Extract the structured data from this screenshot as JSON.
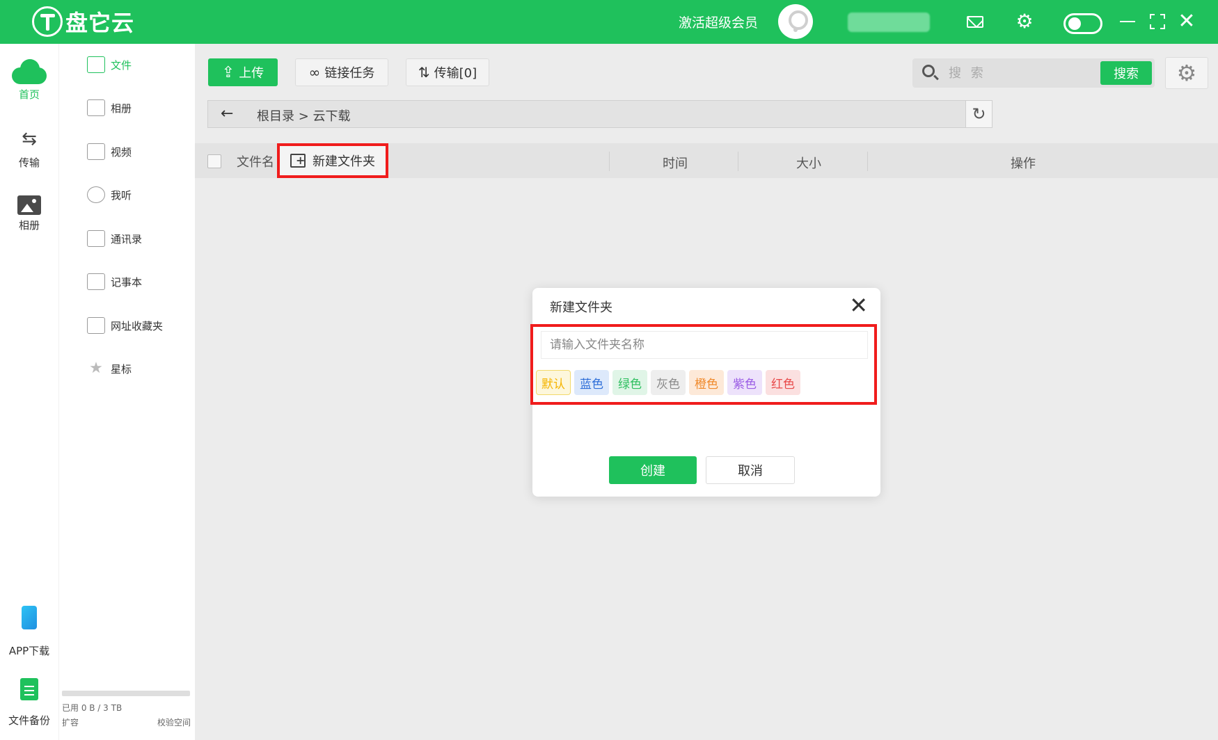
{
  "app": {
    "logo_text": "盘它云",
    "vip_label": "激活超级会员"
  },
  "rail": {
    "items": [
      {
        "label": "首页"
      },
      {
        "label": "传输"
      },
      {
        "label": "相册"
      },
      {
        "label": "APP下载"
      },
      {
        "label": "文件备份"
      }
    ]
  },
  "sidebar": {
    "items": [
      {
        "label": "文件"
      },
      {
        "label": "相册"
      },
      {
        "label": "视频"
      },
      {
        "label": "我听"
      },
      {
        "label": "通讯录"
      },
      {
        "label": "记事本"
      },
      {
        "label": "网址收藏夹"
      },
      {
        "label": "星标"
      }
    ],
    "storage": {
      "used_text": "已用 0 B / 3 TB",
      "used_fraction": 0,
      "expand_label": "扩容",
      "verify_label": "校验空间"
    }
  },
  "toolbar": {
    "upload_label": "上传",
    "link_task_label": "链接任务",
    "transfer_label": "传输[0]",
    "search_placeholder": "搜 索",
    "search_button": "搜索"
  },
  "breadcrumb": {
    "path_text": "根目录 > 云下载"
  },
  "file_table": {
    "col_name": "文件名",
    "new_folder_label": "新建文件夹",
    "col_time": "时间",
    "col_size": "大小",
    "col_action": "操作"
  },
  "modal": {
    "title": "新建文件夹",
    "input_placeholder": "请输入文件夹名称",
    "colors": [
      {
        "label": "默认",
        "text_color": "#f5b400",
        "bg_color": "#fdf7dc",
        "border_color": "#f2d96b"
      },
      {
        "label": "蓝色",
        "text_color": "#2f6fd8",
        "bg_color": "#dde9fb",
        "border_color": "#dde9fb"
      },
      {
        "label": "绿色",
        "text_color": "#2fbf60",
        "bg_color": "#e0f5e7",
        "border_color": "#e0f5e7"
      },
      {
        "label": "灰色",
        "text_color": "#8a8a8a",
        "bg_color": "#eeeeee",
        "border_color": "#eeeeee"
      },
      {
        "label": "橙色",
        "text_color": "#f08a2c",
        "bg_color": "#fde9d8",
        "border_color": "#fde9d8"
      },
      {
        "label": "紫色",
        "text_color": "#9b5de5",
        "bg_color": "#ede2fb",
        "border_color": "#ede2fb"
      },
      {
        "label": "红色",
        "text_color": "#e84a4a",
        "bg_color": "#fbe0e0",
        "border_color": "#fbe0e0"
      }
    ],
    "create_label": "创建",
    "cancel_label": "取消"
  },
  "colors": {
    "brand": "#1fc15c",
    "highlight": "#f01c1c"
  }
}
